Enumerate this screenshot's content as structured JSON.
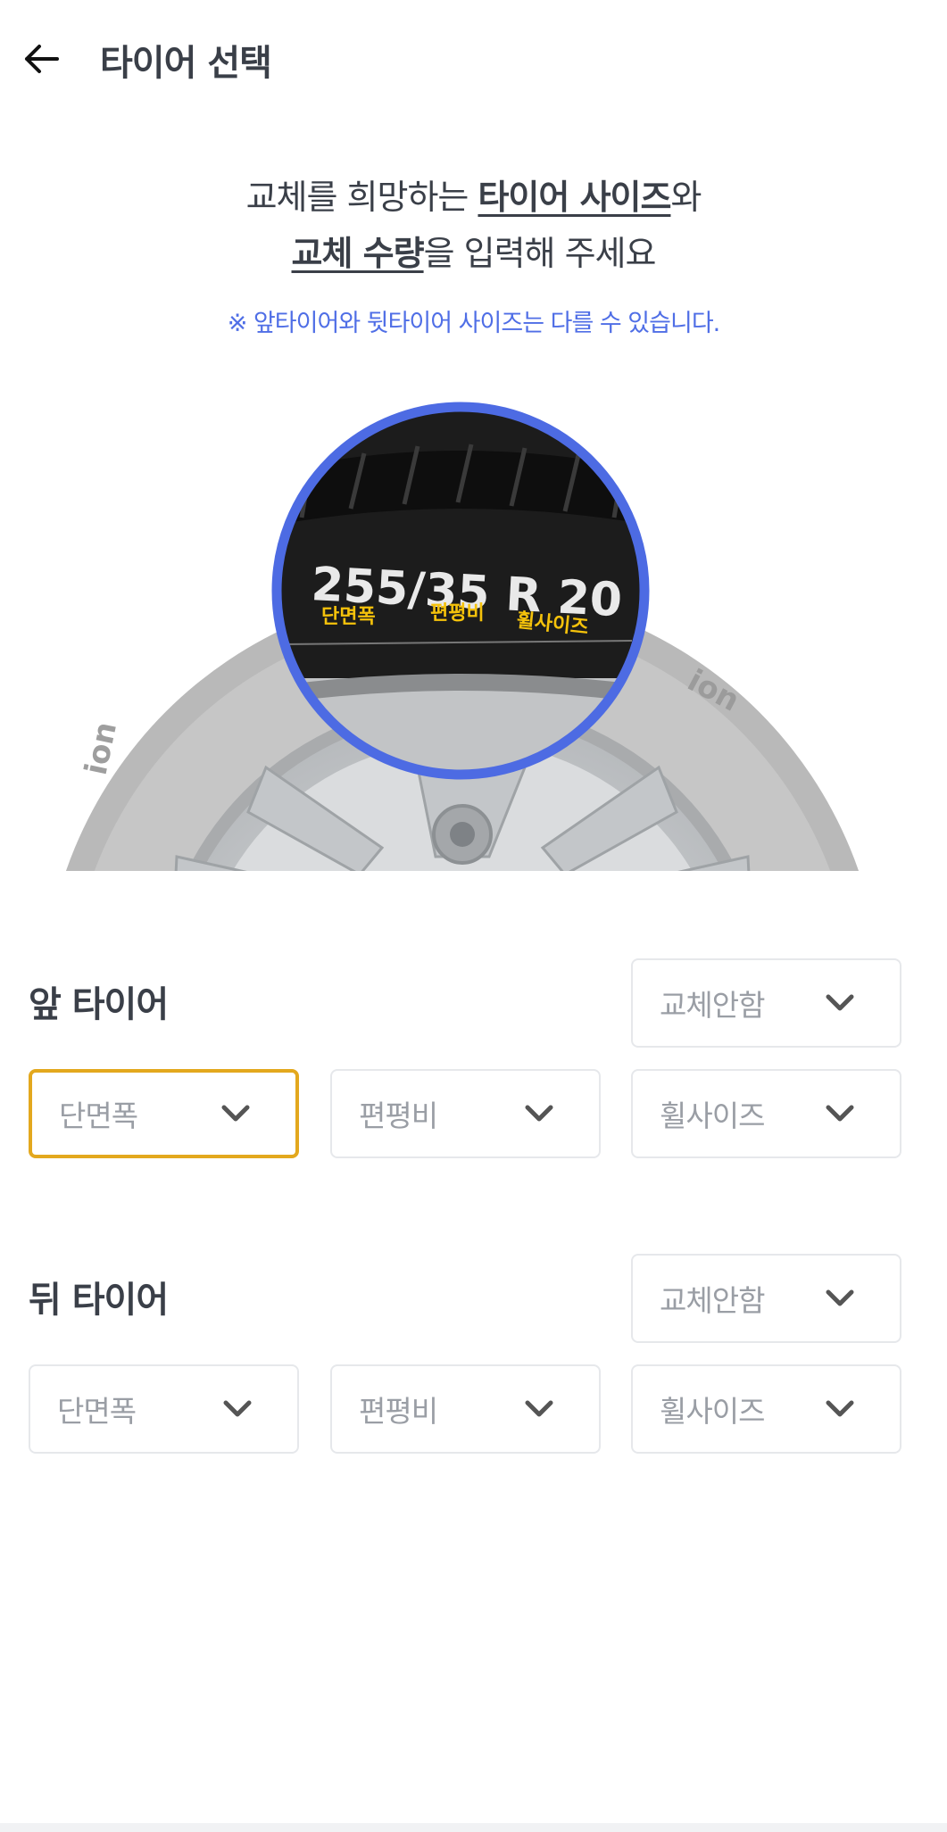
{
  "header": {
    "title": "타이어 선택",
    "back_icon": "arrow-left-icon"
  },
  "instructions": {
    "line1_pre": "교체를 희망하는 ",
    "line1_bold": "타이어 사이즈",
    "line1_post": "와",
    "line2_bold": "교체 수량",
    "line2_post": "을 입력해 주세요",
    "note": "※ 앞타이어와 뒷타이어 사이즈는 다를 수 있습니다."
  },
  "illustration": {
    "size_text": "255/35 R 20",
    "labels": [
      "단면폭",
      "편평비",
      "휠사이즈"
    ]
  },
  "front": {
    "label": "앞 타이어",
    "quantity": "교체안함",
    "width": "단면폭",
    "aspect": "편평비",
    "wheel": "휠사이즈"
  },
  "rear": {
    "label": "뒤 타이어",
    "quantity": "교체안함",
    "width": "단면폭",
    "aspect": "편평비",
    "wheel": "휠사이즈"
  },
  "colors": {
    "accent_blue": "#4f6ee6",
    "focus_border": "#e3a81e",
    "label_yellow": "#f5c20b",
    "text_dark": "#3a3f48",
    "placeholder": "#9a9ea5"
  }
}
